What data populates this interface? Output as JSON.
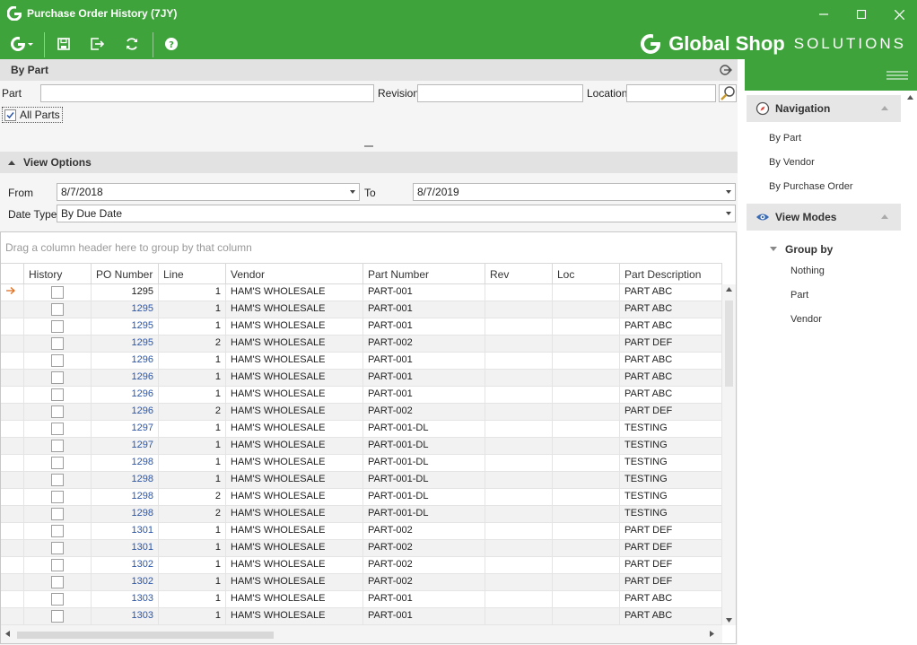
{
  "window": {
    "title": "Purchase Order History (7JY)",
    "controls": [
      "minimize",
      "maximize",
      "close"
    ]
  },
  "toolbar": {
    "buttons": [
      "g-menu-icon",
      "save-icon",
      "export-icon",
      "refresh-icon",
      "help-icon"
    ]
  },
  "brand": {
    "name": "Global Shop",
    "suffix": "SOLUTIONS",
    "color": "#3fa33c"
  },
  "by_part": {
    "header": "By Part",
    "part_label": "Part",
    "part_value": "",
    "revision_label": "Revision",
    "revision_value": "",
    "location_label": "Location",
    "location_value": "",
    "all_parts_label": "All Parts",
    "all_parts_checked": true
  },
  "view_options": {
    "header": "View Options",
    "from_label": "From",
    "from_value": "8/7/2018",
    "to_label": "To",
    "to_value": "8/7/2019",
    "date_type_label": "Date Type",
    "date_type_value": "By Due Date"
  },
  "grid": {
    "group_panel_text": "Drag a column header here to group by that column",
    "columns": [
      "History",
      "PO Number",
      "Line",
      "Vendor",
      "Part Number",
      "Rev",
      "Loc",
      "Part Description"
    ],
    "rows": [
      {
        "po": "1295",
        "line": "1",
        "vendor": "HAM'S WHOLESALE",
        "part": "PART-001",
        "rev": "",
        "loc": "",
        "desc": "PART ABC"
      },
      {
        "po": "1295",
        "line": "1",
        "vendor": "HAM'S WHOLESALE",
        "part": "PART-001",
        "rev": "",
        "loc": "",
        "desc": "PART ABC"
      },
      {
        "po": "1295",
        "line": "1",
        "vendor": "HAM'S WHOLESALE",
        "part": "PART-001",
        "rev": "",
        "loc": "",
        "desc": "PART ABC"
      },
      {
        "po": "1295",
        "line": "2",
        "vendor": "HAM'S WHOLESALE",
        "part": "PART-002",
        "rev": "",
        "loc": "",
        "desc": "PART DEF"
      },
      {
        "po": "1296",
        "line": "1",
        "vendor": "HAM'S WHOLESALE",
        "part": "PART-001",
        "rev": "",
        "loc": "",
        "desc": "PART ABC"
      },
      {
        "po": "1296",
        "line": "1",
        "vendor": "HAM'S WHOLESALE",
        "part": "PART-001",
        "rev": "",
        "loc": "",
        "desc": "PART ABC"
      },
      {
        "po": "1296",
        "line": "1",
        "vendor": "HAM'S WHOLESALE",
        "part": "PART-001",
        "rev": "",
        "loc": "",
        "desc": "PART ABC"
      },
      {
        "po": "1296",
        "line": "2",
        "vendor": "HAM'S WHOLESALE",
        "part": "PART-002",
        "rev": "",
        "loc": "",
        "desc": "PART DEF"
      },
      {
        "po": "1297",
        "line": "1",
        "vendor": "HAM'S WHOLESALE",
        "part": "PART-001-DL",
        "rev": "",
        "loc": "",
        "desc": "TESTING"
      },
      {
        "po": "1297",
        "line": "1",
        "vendor": "HAM'S WHOLESALE",
        "part": "PART-001-DL",
        "rev": "",
        "loc": "",
        "desc": "TESTING"
      },
      {
        "po": "1298",
        "line": "1",
        "vendor": "HAM'S WHOLESALE",
        "part": "PART-001-DL",
        "rev": "",
        "loc": "",
        "desc": "TESTING"
      },
      {
        "po": "1298",
        "line": "1",
        "vendor": "HAM'S WHOLESALE",
        "part": "PART-001-DL",
        "rev": "",
        "loc": "",
        "desc": "TESTING"
      },
      {
        "po": "1298",
        "line": "2",
        "vendor": "HAM'S WHOLESALE",
        "part": "PART-001-DL",
        "rev": "",
        "loc": "",
        "desc": "TESTING"
      },
      {
        "po": "1298",
        "line": "2",
        "vendor": "HAM'S WHOLESALE",
        "part": "PART-001-DL",
        "rev": "",
        "loc": "",
        "desc": "TESTING"
      },
      {
        "po": "1301",
        "line": "1",
        "vendor": "HAM'S WHOLESALE",
        "part": "PART-002",
        "rev": "",
        "loc": "",
        "desc": "PART DEF"
      },
      {
        "po": "1301",
        "line": "1",
        "vendor": "HAM'S WHOLESALE",
        "part": "PART-002",
        "rev": "",
        "loc": "",
        "desc": "PART DEF"
      },
      {
        "po": "1302",
        "line": "1",
        "vendor": "HAM'S WHOLESALE",
        "part": "PART-002",
        "rev": "",
        "loc": "",
        "desc": "PART DEF"
      },
      {
        "po": "1302",
        "line": "1",
        "vendor": "HAM'S WHOLESALE",
        "part": "PART-002",
        "rev": "",
        "loc": "",
        "desc": "PART DEF"
      },
      {
        "po": "1303",
        "line": "1",
        "vendor": "HAM'S WHOLESALE",
        "part": "PART-001",
        "rev": "",
        "loc": "",
        "desc": "PART ABC"
      },
      {
        "po": "1303",
        "line": "1",
        "vendor": "HAM'S WHOLESALE",
        "part": "PART-001",
        "rev": "",
        "loc": "",
        "desc": "PART ABC"
      }
    ]
  },
  "sidebar": {
    "navigation_header": "Navigation",
    "navigation_items": [
      "By Part",
      "By Vendor",
      "By Purchase Order"
    ],
    "view_modes_header": "View Modes",
    "group_by_label": "Group by",
    "group_by_items": [
      "Nothing",
      "Part",
      "Vendor"
    ]
  }
}
